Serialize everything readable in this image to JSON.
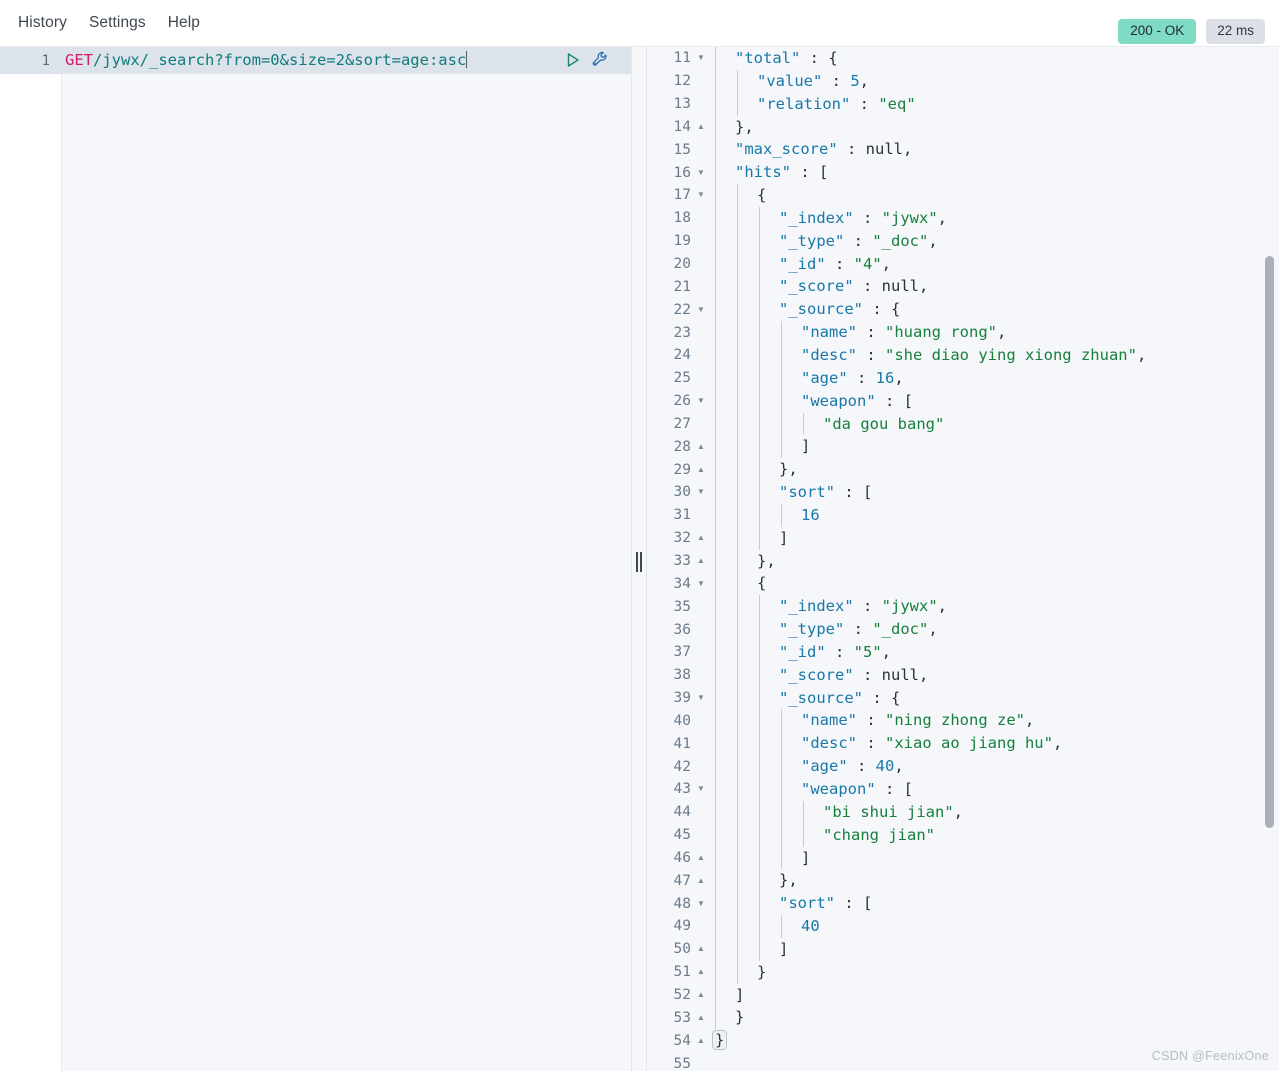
{
  "menu": {
    "items": [
      {
        "label": "History"
      },
      {
        "label": "Settings"
      },
      {
        "label": "Help"
      }
    ]
  },
  "status": {
    "code_label": "200 - OK",
    "time_label": "22 ms",
    "ok_color": "#7fdbc4",
    "time_bg": "#dcdfe6"
  },
  "request": {
    "line_number": "1",
    "method": "GET",
    "path": "/jywx/_search?from=0&size=2&sort=age:asc",
    "play_icon": "play-icon",
    "wrench_icon": "wrench-icon"
  },
  "response": {
    "first_visible_line": 11,
    "last_visible_line": 55,
    "lines": [
      {
        "num": "11",
        "fold": "open",
        "indent": 1,
        "tokens": [
          {
            "t": "k",
            "v": "\"total\""
          },
          {
            "t": "p",
            "v": " : "
          },
          {
            "t": "p",
            "v": "{"
          }
        ]
      },
      {
        "num": "12",
        "fold": "",
        "indent": 2,
        "tokens": [
          {
            "t": "k",
            "v": "\"value\""
          },
          {
            "t": "p",
            "v": " : "
          },
          {
            "t": "n",
            "v": "5"
          },
          {
            "t": "p",
            "v": ","
          }
        ]
      },
      {
        "num": "13",
        "fold": "",
        "indent": 2,
        "tokens": [
          {
            "t": "k",
            "v": "\"relation\""
          },
          {
            "t": "p",
            "v": " : "
          },
          {
            "t": "s",
            "v": "\"eq\""
          }
        ]
      },
      {
        "num": "14",
        "fold": "close",
        "indent": 1,
        "tokens": [
          {
            "t": "p",
            "v": "},"
          }
        ]
      },
      {
        "num": "15",
        "fold": "",
        "indent": 1,
        "tokens": [
          {
            "t": "k",
            "v": "\"max_score\""
          },
          {
            "t": "p",
            "v": " : "
          },
          {
            "t": "nl",
            "v": "null"
          },
          {
            "t": "p",
            "v": ","
          }
        ]
      },
      {
        "num": "16",
        "fold": "open",
        "indent": 1,
        "tokens": [
          {
            "t": "k",
            "v": "\"hits\""
          },
          {
            "t": "p",
            "v": " : "
          },
          {
            "t": "p",
            "v": "["
          }
        ]
      },
      {
        "num": "17",
        "fold": "open",
        "indent": 2,
        "tokens": [
          {
            "t": "p",
            "v": "{"
          }
        ]
      },
      {
        "num": "18",
        "fold": "",
        "indent": 3,
        "tokens": [
          {
            "t": "k",
            "v": "\"_index\""
          },
          {
            "t": "p",
            "v": " : "
          },
          {
            "t": "s",
            "v": "\"jywx\""
          },
          {
            "t": "p",
            "v": ","
          }
        ]
      },
      {
        "num": "19",
        "fold": "",
        "indent": 3,
        "tokens": [
          {
            "t": "k",
            "v": "\"_type\""
          },
          {
            "t": "p",
            "v": " : "
          },
          {
            "t": "s",
            "v": "\"_doc\""
          },
          {
            "t": "p",
            "v": ","
          }
        ]
      },
      {
        "num": "20",
        "fold": "",
        "indent": 3,
        "tokens": [
          {
            "t": "k",
            "v": "\"_id\""
          },
          {
            "t": "p",
            "v": " : "
          },
          {
            "t": "s",
            "v": "\"4\""
          },
          {
            "t": "p",
            "v": ","
          }
        ]
      },
      {
        "num": "21",
        "fold": "",
        "indent": 3,
        "tokens": [
          {
            "t": "k",
            "v": "\"_score\""
          },
          {
            "t": "p",
            "v": " : "
          },
          {
            "t": "nl",
            "v": "null"
          },
          {
            "t": "p",
            "v": ","
          }
        ]
      },
      {
        "num": "22",
        "fold": "open",
        "indent": 3,
        "tokens": [
          {
            "t": "k",
            "v": "\"_source\""
          },
          {
            "t": "p",
            "v": " : "
          },
          {
            "t": "p",
            "v": "{"
          }
        ]
      },
      {
        "num": "23",
        "fold": "",
        "indent": 4,
        "tokens": [
          {
            "t": "k",
            "v": "\"name\""
          },
          {
            "t": "p",
            "v": " : "
          },
          {
            "t": "s",
            "v": "\"huang rong\""
          },
          {
            "t": "p",
            "v": ","
          }
        ]
      },
      {
        "num": "24",
        "fold": "",
        "indent": 4,
        "tokens": [
          {
            "t": "k",
            "v": "\"desc\""
          },
          {
            "t": "p",
            "v": " : "
          },
          {
            "t": "s",
            "v": "\"she diao ying xiong zhuan\""
          },
          {
            "t": "p",
            "v": ","
          }
        ]
      },
      {
        "num": "25",
        "fold": "",
        "indent": 4,
        "tokens": [
          {
            "t": "k",
            "v": "\"age\""
          },
          {
            "t": "p",
            "v": " : "
          },
          {
            "t": "n",
            "v": "16"
          },
          {
            "t": "p",
            "v": ","
          }
        ]
      },
      {
        "num": "26",
        "fold": "open",
        "indent": 4,
        "tokens": [
          {
            "t": "k",
            "v": "\"weapon\""
          },
          {
            "t": "p",
            "v": " : "
          },
          {
            "t": "p",
            "v": "["
          }
        ]
      },
      {
        "num": "27",
        "fold": "",
        "indent": 5,
        "tokens": [
          {
            "t": "s",
            "v": "\"da gou bang\""
          }
        ]
      },
      {
        "num": "28",
        "fold": "close",
        "indent": 4,
        "tokens": [
          {
            "t": "p",
            "v": "]"
          }
        ]
      },
      {
        "num": "29",
        "fold": "close",
        "indent": 3,
        "tokens": [
          {
            "t": "p",
            "v": "},"
          }
        ]
      },
      {
        "num": "30",
        "fold": "open",
        "indent": 3,
        "tokens": [
          {
            "t": "k",
            "v": "\"sort\""
          },
          {
            "t": "p",
            "v": " : "
          },
          {
            "t": "p",
            "v": "["
          }
        ]
      },
      {
        "num": "31",
        "fold": "",
        "indent": 4,
        "tokens": [
          {
            "t": "n",
            "v": "16"
          }
        ]
      },
      {
        "num": "32",
        "fold": "close",
        "indent": 3,
        "tokens": [
          {
            "t": "p",
            "v": "]"
          }
        ]
      },
      {
        "num": "33",
        "fold": "close",
        "indent": 2,
        "tokens": [
          {
            "t": "p",
            "v": "},"
          }
        ]
      },
      {
        "num": "34",
        "fold": "open",
        "indent": 2,
        "tokens": [
          {
            "t": "p",
            "v": "{"
          }
        ]
      },
      {
        "num": "35",
        "fold": "",
        "indent": 3,
        "tokens": [
          {
            "t": "k",
            "v": "\"_index\""
          },
          {
            "t": "p",
            "v": " : "
          },
          {
            "t": "s",
            "v": "\"jywx\""
          },
          {
            "t": "p",
            "v": ","
          }
        ]
      },
      {
        "num": "36",
        "fold": "",
        "indent": 3,
        "tokens": [
          {
            "t": "k",
            "v": "\"_type\""
          },
          {
            "t": "p",
            "v": " : "
          },
          {
            "t": "s",
            "v": "\"_doc\""
          },
          {
            "t": "p",
            "v": ","
          }
        ]
      },
      {
        "num": "37",
        "fold": "",
        "indent": 3,
        "tokens": [
          {
            "t": "k",
            "v": "\"_id\""
          },
          {
            "t": "p",
            "v": " : "
          },
          {
            "t": "s",
            "v": "\"5\""
          },
          {
            "t": "p",
            "v": ","
          }
        ]
      },
      {
        "num": "38",
        "fold": "",
        "indent": 3,
        "tokens": [
          {
            "t": "k",
            "v": "\"_score\""
          },
          {
            "t": "p",
            "v": " : "
          },
          {
            "t": "nl",
            "v": "null"
          },
          {
            "t": "p",
            "v": ","
          }
        ]
      },
      {
        "num": "39",
        "fold": "open",
        "indent": 3,
        "tokens": [
          {
            "t": "k",
            "v": "\"_source\""
          },
          {
            "t": "p",
            "v": " : "
          },
          {
            "t": "p",
            "v": "{"
          }
        ]
      },
      {
        "num": "40",
        "fold": "",
        "indent": 4,
        "tokens": [
          {
            "t": "k",
            "v": "\"name\""
          },
          {
            "t": "p",
            "v": " : "
          },
          {
            "t": "s",
            "v": "\"ning zhong ze\""
          },
          {
            "t": "p",
            "v": ","
          }
        ]
      },
      {
        "num": "41",
        "fold": "",
        "indent": 4,
        "tokens": [
          {
            "t": "k",
            "v": "\"desc\""
          },
          {
            "t": "p",
            "v": " : "
          },
          {
            "t": "s",
            "v": "\"xiao ao jiang hu\""
          },
          {
            "t": "p",
            "v": ","
          }
        ]
      },
      {
        "num": "42",
        "fold": "",
        "indent": 4,
        "tokens": [
          {
            "t": "k",
            "v": "\"age\""
          },
          {
            "t": "p",
            "v": " : "
          },
          {
            "t": "n",
            "v": "40"
          },
          {
            "t": "p",
            "v": ","
          }
        ]
      },
      {
        "num": "43",
        "fold": "open",
        "indent": 4,
        "tokens": [
          {
            "t": "k",
            "v": "\"weapon\""
          },
          {
            "t": "p",
            "v": " : "
          },
          {
            "t": "p",
            "v": "["
          }
        ]
      },
      {
        "num": "44",
        "fold": "",
        "indent": 5,
        "tokens": [
          {
            "t": "s",
            "v": "\"bi shui jian\""
          },
          {
            "t": "p",
            "v": ","
          }
        ]
      },
      {
        "num": "45",
        "fold": "",
        "indent": 5,
        "tokens": [
          {
            "t": "s",
            "v": "\"chang jian\""
          }
        ]
      },
      {
        "num": "46",
        "fold": "close",
        "indent": 4,
        "tokens": [
          {
            "t": "p",
            "v": "]"
          }
        ]
      },
      {
        "num": "47",
        "fold": "close",
        "indent": 3,
        "tokens": [
          {
            "t": "p",
            "v": "},"
          }
        ]
      },
      {
        "num": "48",
        "fold": "open",
        "indent": 3,
        "tokens": [
          {
            "t": "k",
            "v": "\"sort\""
          },
          {
            "t": "p",
            "v": " : "
          },
          {
            "t": "p",
            "v": "["
          }
        ]
      },
      {
        "num": "49",
        "fold": "",
        "indent": 4,
        "tokens": [
          {
            "t": "n",
            "v": "40"
          }
        ]
      },
      {
        "num": "50",
        "fold": "close",
        "indent": 3,
        "tokens": [
          {
            "t": "p",
            "v": "]"
          }
        ]
      },
      {
        "num": "51",
        "fold": "close",
        "indent": 2,
        "tokens": [
          {
            "t": "p",
            "v": "}"
          }
        ]
      },
      {
        "num": "52",
        "fold": "close",
        "indent": 1,
        "tokens": [
          {
            "t": "p",
            "v": "]"
          }
        ]
      },
      {
        "num": "53",
        "fold": "close",
        "indent": 1,
        "tokens": [
          {
            "t": "p",
            "v": "}"
          }
        ]
      },
      {
        "num": "54",
        "fold": "close",
        "indent": 0,
        "tokens": [
          {
            "t": "p",
            "v": "}",
            "hl": true
          }
        ]
      },
      {
        "num": "55",
        "fold": "",
        "indent": 0,
        "tokens": []
      }
    ]
  },
  "watermark": "CSDN @FeenixOne"
}
